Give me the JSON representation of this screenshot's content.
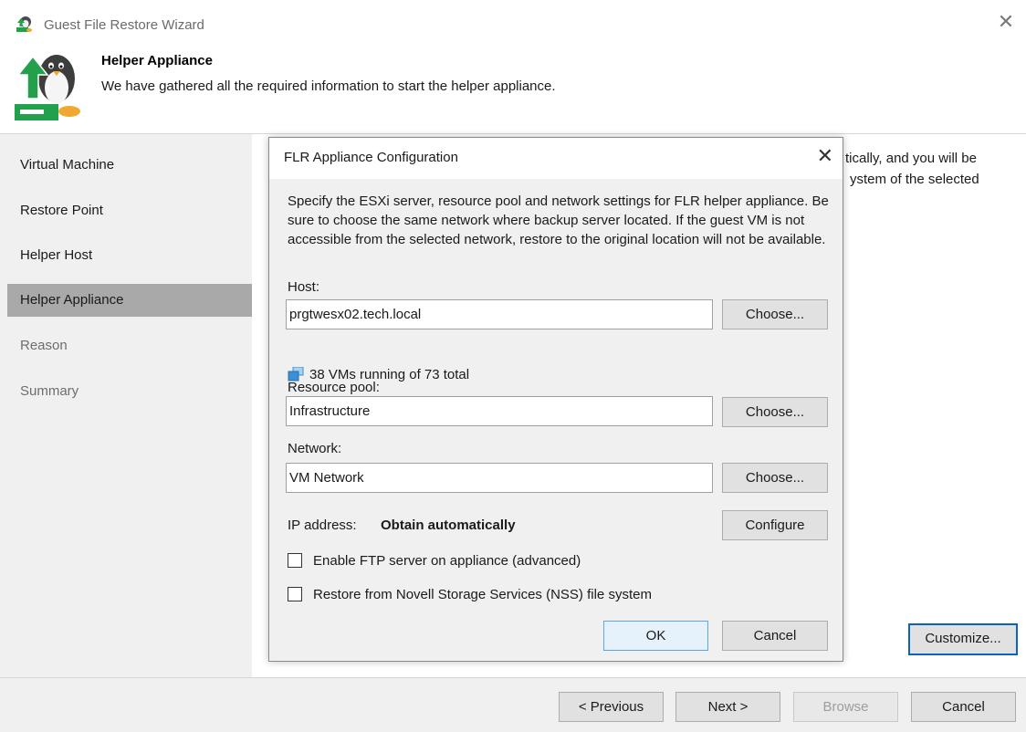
{
  "window": {
    "title": "Guest File Restore Wizard",
    "close_glyph": "✕"
  },
  "header": {
    "title": "Helper Appliance",
    "subtitle": "We have gathered all the required information to start the helper appliance."
  },
  "sidebar": {
    "items": [
      {
        "label": "Virtual Machine",
        "state": "normal"
      },
      {
        "label": "Restore Point",
        "state": "normal"
      },
      {
        "label": "Helper Host",
        "state": "normal"
      },
      {
        "label": "Helper Appliance",
        "state": "active"
      },
      {
        "label": "Reason",
        "state": "disabled"
      },
      {
        "label": "Summary",
        "state": "disabled"
      }
    ]
  },
  "content": {
    "partial_line_1": "tically, and you will be",
    "partial_line_2": "ystem of the selected",
    "customize_label": "Customize..."
  },
  "footer": {
    "previous_label": "< Previous",
    "next_label": "Next >",
    "browse_label": "Browse",
    "cancel_label": "Cancel"
  },
  "dialog": {
    "title": "FLR Appliance Configuration",
    "close_glyph": "✕",
    "description": "Specify the ESXi server, resource pool and network settings for FLR helper appliance. Be sure to choose the same network where backup server located. If the guest VM is not accessible from the selected network, restore to the original location will not be available.",
    "host_label": "Host:",
    "host_value": "prgtwesx02.tech.local",
    "host_choose": "Choose...",
    "vm_status": "38 VMs running of 73 total",
    "pool_label": "Resource pool:",
    "pool_value": "Infrastructure",
    "pool_choose": "Choose...",
    "network_label": "Network:",
    "network_value": "VM Network",
    "network_choose": "Choose...",
    "ip_label": "IP address:",
    "ip_value": "Obtain automatically",
    "configure_label": "Configure",
    "ftp_checkbox": {
      "label": "Enable FTP server on appliance (advanced)",
      "checked": false
    },
    "nss_checkbox": {
      "label": "Restore from Novell Storage Services (NSS) file system",
      "checked": false
    },
    "ok_label": "OK",
    "cancel_label": "Cancel"
  },
  "colors": {
    "accent_green": "#22a04b",
    "active_sidebar": "#a9a9a9",
    "focus_border": "#0a62c5",
    "vm_icon_blue": "#3b8fd6"
  }
}
